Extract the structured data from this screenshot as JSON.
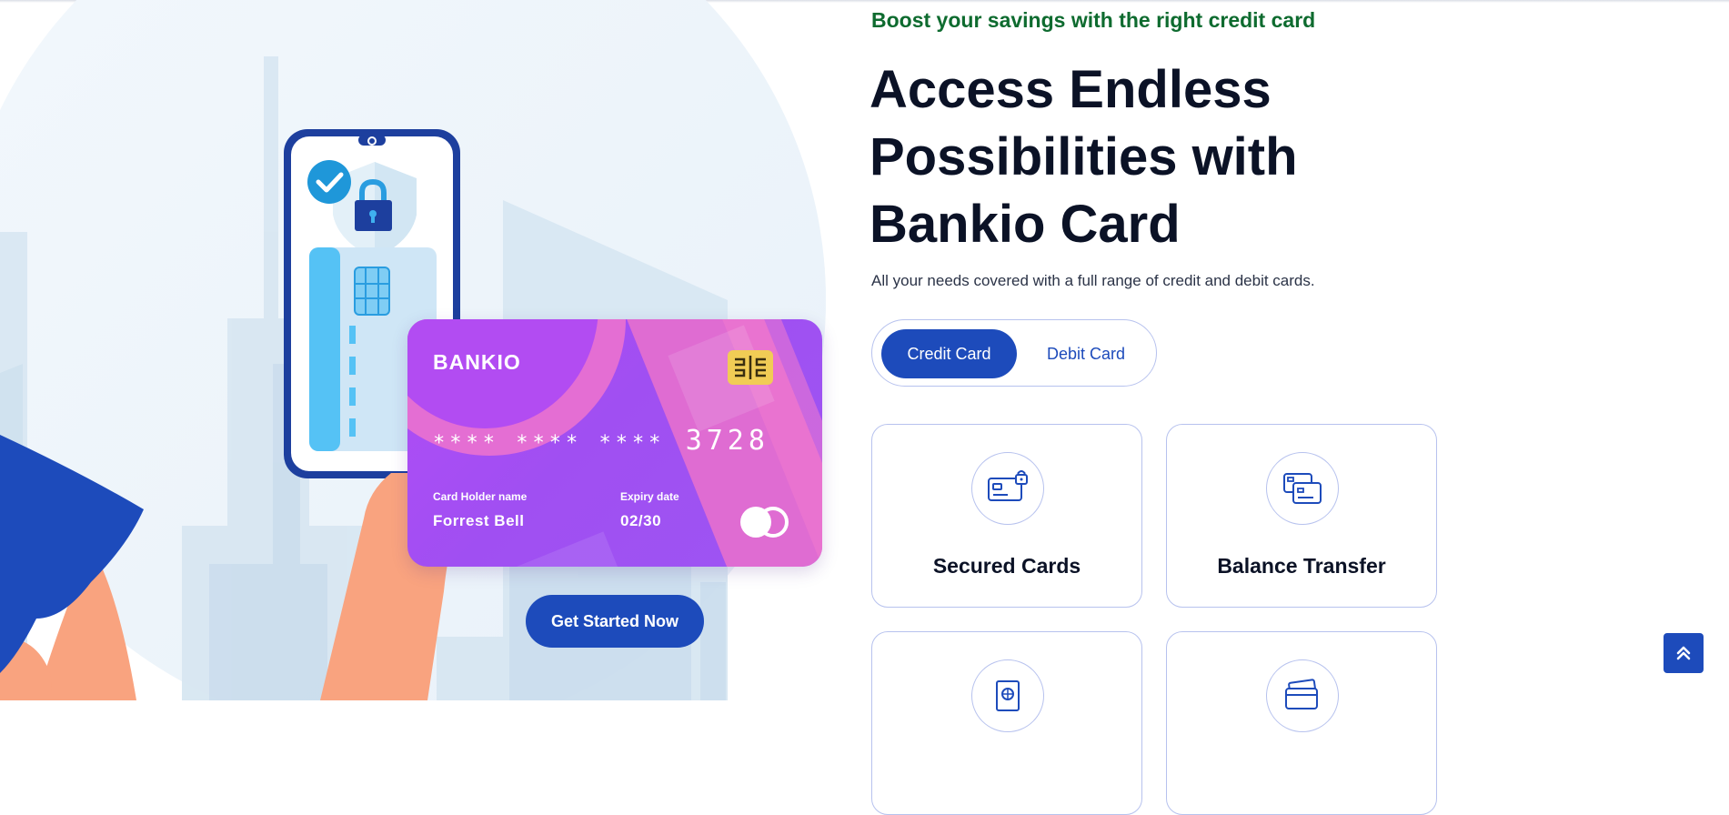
{
  "hero": {
    "card": {
      "brand": "BANKIO",
      "masked_groups": "**** **** ****",
      "last_digits": "3728",
      "holder_label": "Card Holder name",
      "holder_name": "Forrest Bell",
      "expiry_label": "Expiry date",
      "expiry_value": "02/30"
    },
    "cta_label": "Get Started Now"
  },
  "content": {
    "eyebrow": "Boost your savings with the right credit card",
    "headline_line1": "Access Endless",
    "headline_line2": "Possibilities with",
    "headline_line3": "Bankio Card",
    "subtitle": "All your needs covered with a full range of credit and debit cards.",
    "tabs": {
      "credit": "Credit Card",
      "debit": "Debit Card",
      "active": "credit"
    },
    "features": [
      {
        "title": "Secured Cards",
        "icon": "secured-card-icon"
      },
      {
        "title": "Balance Transfer",
        "icon": "balance-transfer-icon"
      },
      {
        "title": "",
        "icon": "passport-card-icon"
      },
      {
        "title": "",
        "icon": "stacked-cards-icon"
      }
    ]
  },
  "colors": {
    "primary": "#1d4bbb",
    "eyebrow_green": "#0e6b2f",
    "heading": "#0b1226",
    "card_purple": "#a04ff2",
    "card_pink": "#e46ed3",
    "chip_gold": "#f1cc55",
    "skin": "#f9a37f",
    "border": "#b7c2ee"
  },
  "scroll_top_icon": "double-chevron-up-icon"
}
